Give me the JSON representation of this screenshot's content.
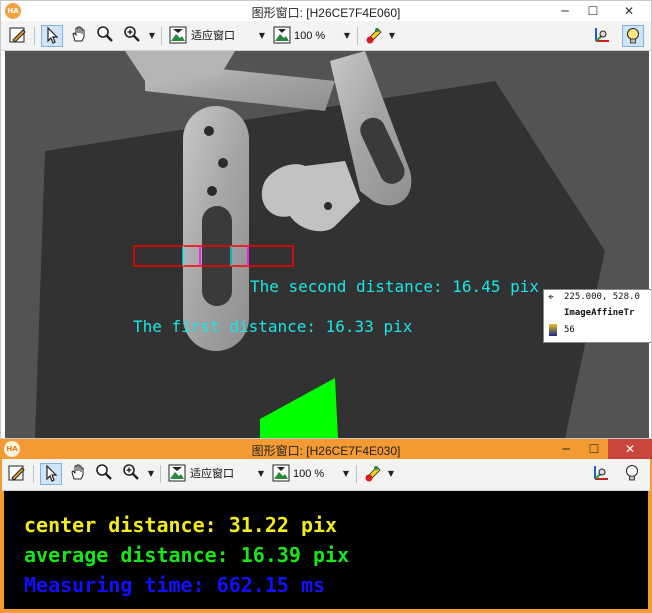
{
  "window1": {
    "title": "图形窗口: [H26CE7F4E060]",
    "app_badge": "HA",
    "minimize": "─",
    "maximize": "☐",
    "close": "✕",
    "toolbar": {
      "fit_label": "适应窗口",
      "zoom_label": "100 %"
    },
    "overlay": {
      "second_distance": "The second distance: 16.45 pix",
      "first_distance": "The first distance: 16.33 pix"
    },
    "tooltip": {
      "coords": "225.000, 528.0",
      "name": "ImageAffineTr",
      "gray": "56"
    }
  },
  "window2": {
    "title": "图形窗口: [H26CE7F4E030]",
    "app_badge": "HA",
    "minimize": "─",
    "maximize": "☐",
    "close": "✕",
    "toolbar": {
      "fit_label": "适应窗口",
      "zoom_label": "100 %"
    },
    "results": {
      "center": "center distance: 31.22 pix",
      "average": "average distance: 16.39 pix",
      "time": "Measuring time: 662.15 ms"
    }
  },
  "colors": {
    "center": "#f2ec1c",
    "average": "#19e619",
    "time": "#1010ff",
    "overlay_text": "#19e6e6",
    "roi_red": "#ff0000",
    "roi_magenta": "#ff00ff",
    "roi_cyan": "#00ffff",
    "green_shape": "#00ff00"
  },
  "icons": [
    "pencil-icon",
    "pointer-icon",
    "hand-icon",
    "magnifier-icon",
    "zoom-in-icon",
    "image-fit-icon",
    "image-zoom-icon",
    "color-picker-icon",
    "axis-icon",
    "bulb-icon"
  ]
}
